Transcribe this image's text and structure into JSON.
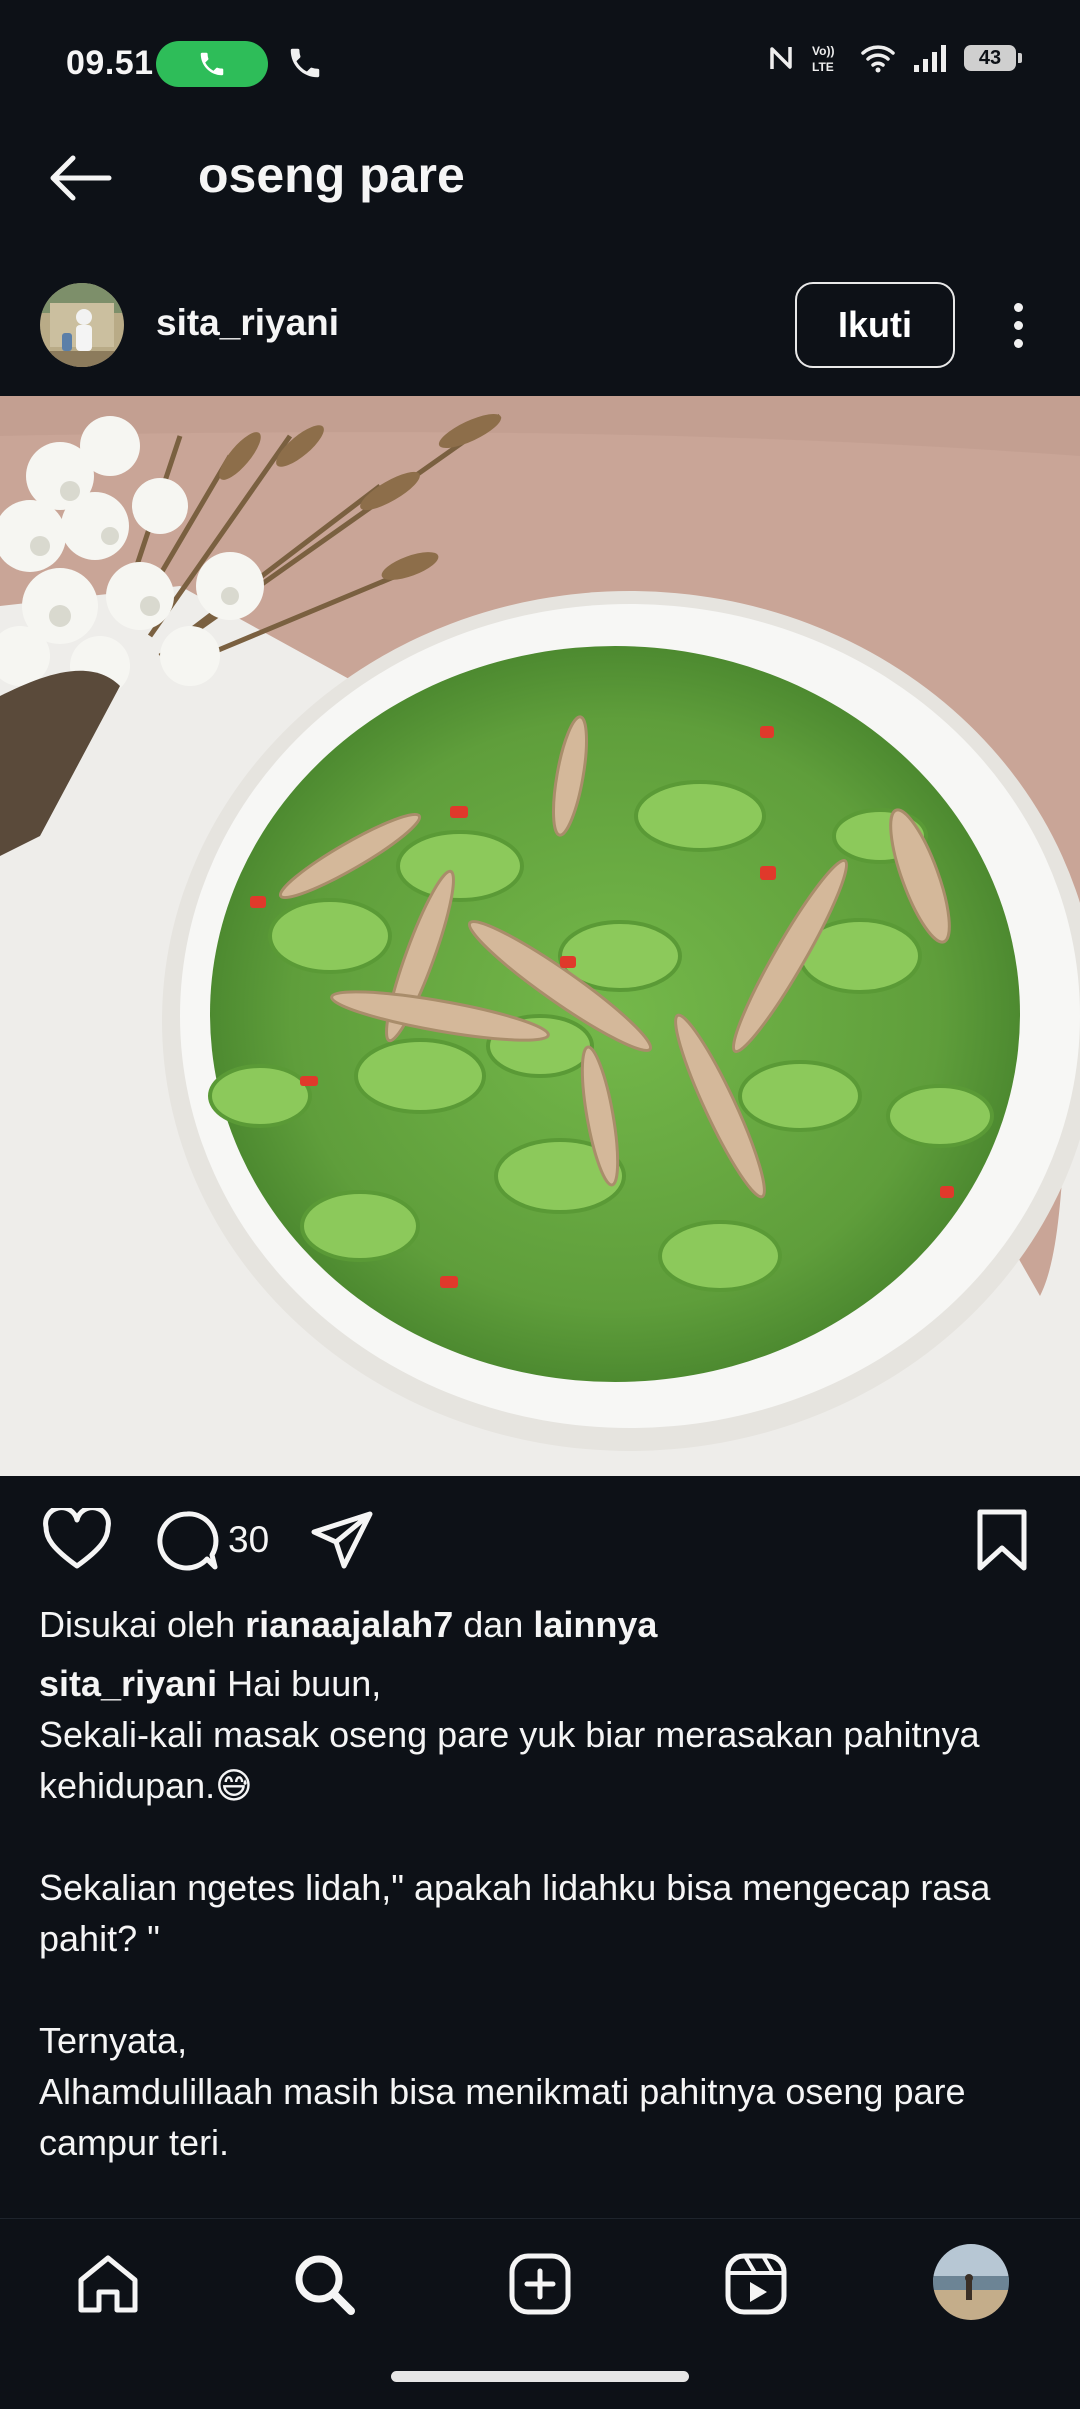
{
  "status_bar": {
    "time": "09.51",
    "battery": "43",
    "icons": [
      "call-active-icon",
      "phone-icon",
      "nfc-icon",
      "volte-icon",
      "wifi-icon",
      "signal-icon",
      "battery-icon"
    ]
  },
  "header": {
    "title": "oseng pare",
    "back_icon": "arrow-left-icon"
  },
  "post": {
    "username": "sita_riyani",
    "follow_label": "Ikuti",
    "comment_count": "30",
    "likes": {
      "prefix": "Disukai oleh",
      "user": "rianaajalah7",
      "connector": "dan",
      "others": "lainnya"
    },
    "caption": {
      "user": "sita_riyani",
      "first": "Hai buun,",
      "line2": "Sekali-kali masak oseng pare yuk biar  merasakan pahitnya",
      "line3": "kehidupan.😅",
      "line4": "",
      "line5": "Sekalian ngetes lidah,\" apakah lidahku bisa mengecap rasa",
      "line6": "pahit? \"",
      "line7": "",
      "line8": "Ternyata,",
      "line9": "Alhamdulillaah masih bisa menikmati pahitnya oseng pare",
      "line10": "campur teri."
    }
  },
  "bottom_nav": [
    "home-icon",
    "search-icon",
    "create-post-icon",
    "reels-icon",
    "profile-avatar"
  ],
  "colors": {
    "background": "#0d1117",
    "call_pill": "#2ebd59",
    "text": "#f5f5f5"
  }
}
